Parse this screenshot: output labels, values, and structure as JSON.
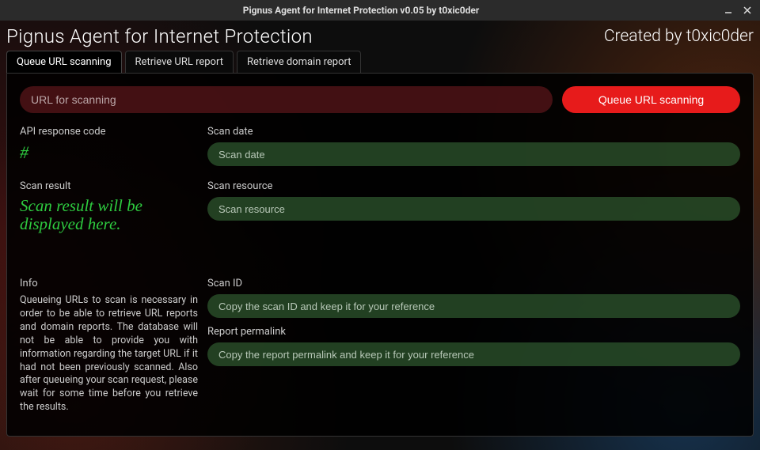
{
  "window": {
    "title": "Pignus Agent for Internet Protection v0.05 by t0xic0der"
  },
  "header": {
    "app_title": "Pignus Agent for Internet Protection",
    "credit": "Created by t0xic0der"
  },
  "tabs": [
    {
      "label": "Queue URL scanning",
      "active": true
    },
    {
      "label": "Retrieve URL report",
      "active": false
    },
    {
      "label": "Retrieve domain report",
      "active": false
    }
  ],
  "url_input": {
    "placeholder": "URL for scanning",
    "value": ""
  },
  "queue_button": {
    "label": "Queue URL scanning"
  },
  "api_response": {
    "label": "API response code",
    "value": "#"
  },
  "scan_date": {
    "label": "Scan date",
    "placeholder": "Scan date",
    "value": ""
  },
  "scan_result": {
    "label": "Scan result",
    "value": "Scan result will be displayed here."
  },
  "scan_resource": {
    "label": "Scan resource",
    "placeholder": "Scan resource",
    "value": ""
  },
  "info": {
    "label": "Info",
    "text": "Queueing URLs to scan is necessary in order to be able to retrieve URL reports and domain reports. The database will not be able to provide you with information regarding the target URL if it had not been previously scanned. Also after queueing your scan request, please wait for some time before you retrieve the results."
  },
  "scan_id": {
    "label": "Scan ID",
    "placeholder": "Copy the scan ID and keep it for your reference",
    "value": ""
  },
  "report_permalink": {
    "label": "Report permalink",
    "placeholder": "Copy the report permalink and keep it for your reference",
    "value": ""
  }
}
